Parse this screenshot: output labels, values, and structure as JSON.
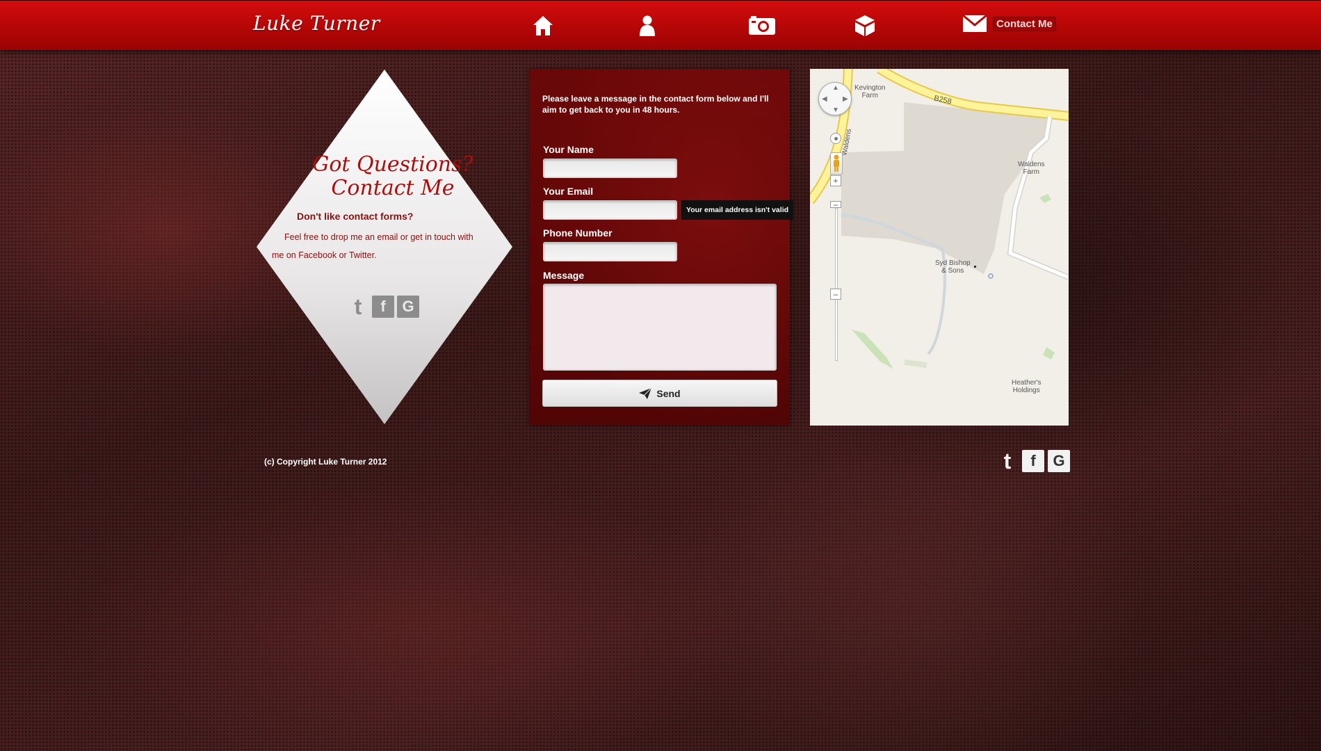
{
  "header": {
    "logo": "Luke Turner",
    "nav": [
      {
        "name": "home",
        "icon": "home-icon"
      },
      {
        "name": "about",
        "icon": "person-icon"
      },
      {
        "name": "photos",
        "icon": "camera-icon"
      },
      {
        "name": "portfolio",
        "icon": "box-icon"
      },
      {
        "name": "contact",
        "icon": "mail-icon",
        "label": "Contact Me"
      }
    ]
  },
  "diamond": {
    "title_line1": "Got Questions?",
    "title_line2": "Contact Me",
    "subtitle": "Don't like contact forms?",
    "body": "Feel free to drop me an email or get in touch with me on Facebook or Twitter.",
    "social": [
      "t",
      "f",
      "G"
    ]
  },
  "form": {
    "intro": "Please leave a message in the contact form below and I'll aim to get back to you in 48 hours.",
    "name_label": "Your Name",
    "name_value": "",
    "email_label": "Your Email",
    "email_value": "",
    "email_error": "Your email address isn't valid",
    "phone_label": "Phone Number",
    "phone_value": "",
    "message_label": "Message",
    "message_value": "",
    "send_label": "Send"
  },
  "map": {
    "labels": {
      "kevington": "Kevington\nFarm",
      "road": "B258",
      "waldens_farm": "Waldens\nFarm",
      "waldens_road": "Waldens",
      "syd_bishop": "Syd Bishop\n& Sons",
      "heathers": "Heather's\nHoldings"
    },
    "colors": {
      "road": "#fdf39a",
      "land": "#f2efe9",
      "building": "#ddd8cf"
    }
  },
  "footer": {
    "copyright": "(c) Copyright Luke Turner 2012",
    "social": [
      "t",
      "f",
      "G"
    ]
  },
  "colors": {
    "brand_red": "#c00808",
    "panel_red": "#5e0606",
    "diamond_text": "#a00c0c"
  }
}
